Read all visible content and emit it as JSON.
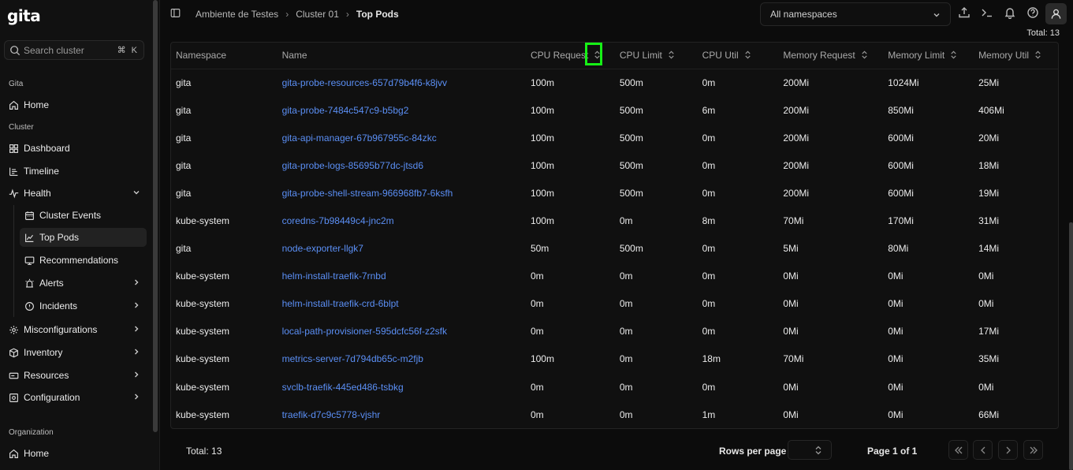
{
  "app": {
    "logo": "gita"
  },
  "sidebar": {
    "search_placeholder": "Search cluster",
    "search_shortcut": "⌘ K",
    "sections": {
      "gita": "Gita",
      "cluster": "Cluster",
      "organization": "Organization"
    },
    "items": {
      "home": "Home",
      "dashboard": "Dashboard",
      "timeline": "Timeline",
      "health": "Health",
      "cluster_events": "Cluster Events",
      "top_pods": "Top Pods",
      "recommendations": "Recommendations",
      "alerts": "Alerts",
      "incidents": "Incidents",
      "misconfigurations": "Misconfigurations",
      "inventory": "Inventory",
      "resources": "Resources",
      "configuration": "Configuration",
      "org_home": "Home"
    }
  },
  "header": {
    "breadcrumb": [
      "Ambiente de Testes",
      "Cluster 01",
      "Top Pods"
    ],
    "namespace_select": "All namespaces"
  },
  "table": {
    "total_label": "Total: 13",
    "columns": [
      "Namespace",
      "Name",
      "CPU Request",
      "CPU Limit",
      "CPU Util",
      "Memory Request",
      "Memory Limit",
      "Memory Util"
    ],
    "rows": [
      [
        "gita",
        "gita-probe-resources-657d79b4f6-k8jvv",
        "100m",
        "500m",
        "0m",
        "200Mi",
        "1024Mi",
        "25Mi"
      ],
      [
        "gita",
        "gita-probe-7484c547c9-b5bg2",
        "100m",
        "500m",
        "6m",
        "200Mi",
        "850Mi",
        "406Mi"
      ],
      [
        "gita",
        "gita-api-manager-67b967955c-84zkc",
        "100m",
        "500m",
        "0m",
        "200Mi",
        "600Mi",
        "20Mi"
      ],
      [
        "gita",
        "gita-probe-logs-85695b77dc-jtsd6",
        "100m",
        "500m",
        "0m",
        "200Mi",
        "600Mi",
        "18Mi"
      ],
      [
        "gita",
        "gita-probe-shell-stream-966968fb7-6ksfh",
        "100m",
        "500m",
        "0m",
        "200Mi",
        "600Mi",
        "19Mi"
      ],
      [
        "kube-system",
        "coredns-7b98449c4-jnc2m",
        "100m",
        "0m",
        "8m",
        "70Mi",
        "170Mi",
        "31Mi"
      ],
      [
        "gita",
        "node-exporter-llgk7",
        "50m",
        "500m",
        "0m",
        "5Mi",
        "80Mi",
        "14Mi"
      ],
      [
        "kube-system",
        "helm-install-traefik-7rnbd",
        "0m",
        "0m",
        "0m",
        "0Mi",
        "0Mi",
        "0Mi"
      ],
      [
        "kube-system",
        "helm-install-traefik-crd-6blpt",
        "0m",
        "0m",
        "0m",
        "0Mi",
        "0Mi",
        "0Mi"
      ],
      [
        "kube-system",
        "local-path-provisioner-595dcfc56f-z2sfk",
        "0m",
        "0m",
        "0m",
        "0Mi",
        "0Mi",
        "17Mi"
      ],
      [
        "kube-system",
        "metrics-server-7d794db65c-m2fjb",
        "100m",
        "0m",
        "18m",
        "70Mi",
        "0Mi",
        "35Mi"
      ],
      [
        "kube-system",
        "svclb-traefik-445ed486-tsbkg",
        "0m",
        "0m",
        "0m",
        "0Mi",
        "0Mi",
        "0Mi"
      ],
      [
        "kube-system",
        "traefik-d7c9c5778-vjshr",
        "0m",
        "0m",
        "1m",
        "0Mi",
        "0Mi",
        "66Mi"
      ]
    ]
  },
  "footer": {
    "total_label": "Total: 13",
    "rows_per_page_label": "Rows per page",
    "page_info": "Page 1 of 1"
  },
  "colors": {
    "link": "#5b8ff5",
    "highlight": "#16f016",
    "background": "#0c0c0c"
  }
}
